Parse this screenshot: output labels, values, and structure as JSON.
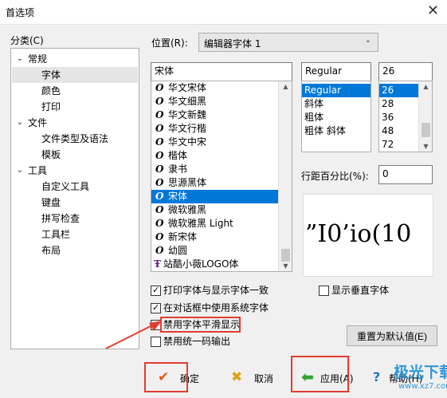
{
  "window": {
    "title": "首选项"
  },
  "sidebar": {
    "label": "分类(C)",
    "items": [
      {
        "label": "常规",
        "level": 0,
        "expanded": true
      },
      {
        "label": "字体",
        "level": 1,
        "selected": true
      },
      {
        "label": "颜色",
        "level": 1
      },
      {
        "label": "打印",
        "level": 1
      },
      {
        "label": "文件",
        "level": 0,
        "expanded": true
      },
      {
        "label": "文件类型及语法",
        "level": 1
      },
      {
        "label": "模板",
        "level": 1
      },
      {
        "label": "工具",
        "level": 0,
        "expanded": true
      },
      {
        "label": "自定义工具",
        "level": 1
      },
      {
        "label": "键盘",
        "level": 1
      },
      {
        "label": "拼写检查",
        "level": 1
      },
      {
        "label": "工具栏",
        "level": 1
      },
      {
        "label": "布局",
        "level": 1
      }
    ]
  },
  "position": {
    "label": "位置(R):",
    "value": "编辑器字体 1"
  },
  "font": {
    "name_value": "宋体",
    "list": [
      {
        "name": "华文宋体",
        "icon": "O"
      },
      {
        "name": "华文细黑",
        "icon": "O"
      },
      {
        "name": "华文新魏",
        "icon": "O"
      },
      {
        "name": "华文行楷",
        "icon": "O"
      },
      {
        "name": "华文中宋",
        "icon": "O"
      },
      {
        "name": "楷体",
        "icon": "O"
      },
      {
        "name": "隶书",
        "icon": "O"
      },
      {
        "name": "思源黑体",
        "icon": "O"
      },
      {
        "name": "宋体",
        "icon": "O",
        "selected": true
      },
      {
        "name": "微软雅黑",
        "icon": "O"
      },
      {
        "name": "微软雅黑 Light",
        "icon": "O"
      },
      {
        "name": "新宋体",
        "icon": "O"
      },
      {
        "name": "幼圆",
        "icon": "O"
      },
      {
        "name": "站酷小薇LOGO体",
        "icon": "TT"
      }
    ]
  },
  "style": {
    "value": "Regular",
    "list": [
      {
        "name": "Regular",
        "selected": true
      },
      {
        "name": "斜体"
      },
      {
        "name": "粗体"
      },
      {
        "name": "粗体 斜体"
      }
    ]
  },
  "size": {
    "value": "26",
    "list": [
      {
        "name": "26",
        "selected": true
      },
      {
        "name": "28"
      },
      {
        "name": "36"
      },
      {
        "name": "48"
      },
      {
        "name": "72"
      }
    ]
  },
  "line_spacing": {
    "label": "行距百分比(%):",
    "value": "0"
  },
  "preview": {
    "text": "”I0’io(10"
  },
  "options": {
    "print_consistent": {
      "label": "打印字体与显示字体一致",
      "checked": true
    },
    "system_font": {
      "label": "在对话框中使用系统字体",
      "checked": true
    },
    "disable_smoothing": {
      "label": "禁用字体平滑显示",
      "checked": false
    },
    "disable_unicode": {
      "label": "禁用统一码输出",
      "checked": false
    },
    "show_vertical": {
      "label": "显示垂直字体",
      "checked": false
    }
  },
  "buttons": {
    "reset": "重置为默认值(E)",
    "ok": "确定",
    "cancel": "取消",
    "apply": "应用(A)",
    "help": "帮助(H)"
  },
  "watermark": {
    "line1": "极光下载站",
    "line2": "www.xz7.com"
  },
  "colors": {
    "selection": "#0078d7",
    "annotation": "#e23b30"
  }
}
